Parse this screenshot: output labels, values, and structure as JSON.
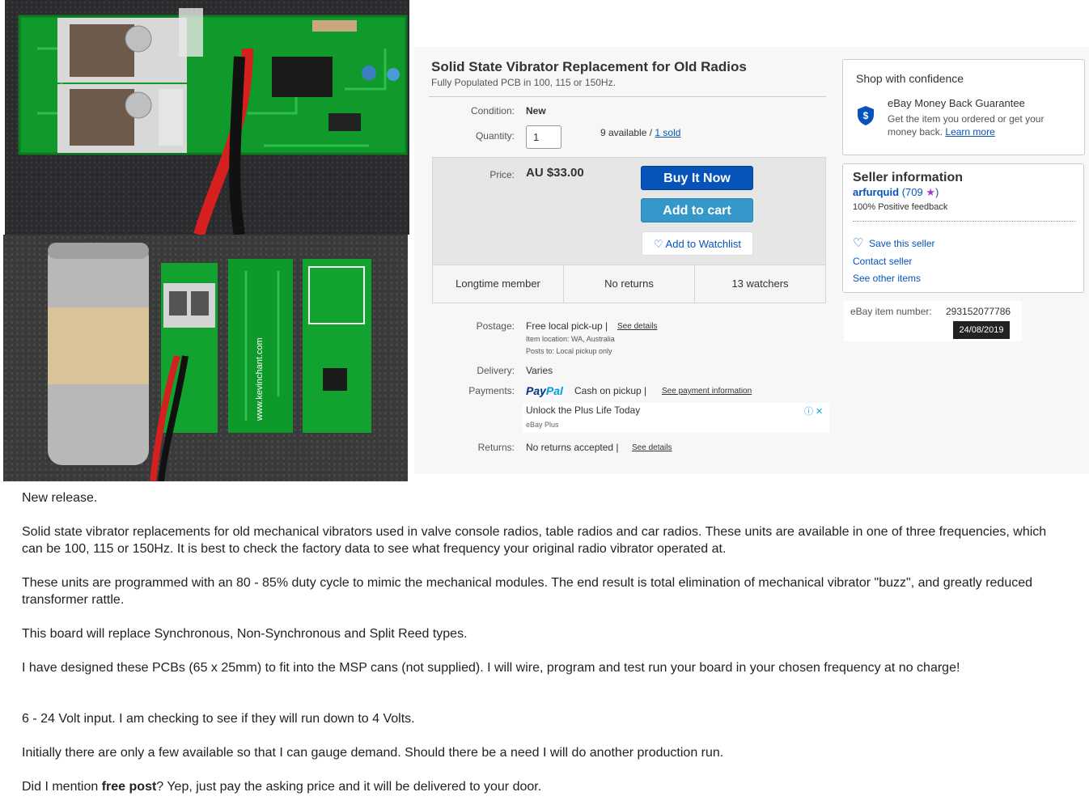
{
  "listing": {
    "title": "Solid State Vibrator Replacement for Old Radios",
    "subtitle": "Fully Populated PCB in 100, 115 or 150Hz.",
    "condition_label": "Condition:",
    "condition_value": "New",
    "quantity_label": "Quantity:",
    "quantity_value": "1",
    "available_text": "9 available /",
    "sold_link": "1 sold",
    "price_label": "Price:",
    "price_value": "AU $33.00",
    "buy_label": "Buy It Now",
    "cart_label": "Add to cart",
    "watch_label": "Add to Watchlist",
    "stats": [
      "Longtime member",
      "No returns",
      "13 watchers"
    ],
    "postage_label": "Postage:",
    "postage_value": "Free local pick-up |",
    "postage_link": "See details",
    "item_location": "Item location:  WA, Australia",
    "posts_to": "Posts to:  Local pickup only",
    "delivery_label": "Delivery:",
    "delivery_value": "Varies",
    "payments_label": "Payments:",
    "paypal_1": "Pay",
    "paypal_2": "Pal",
    "cash_value": "Cash on pickup  |",
    "payment_link": "See payment information",
    "ad_title": "Unlock the Plus Life Today",
    "ad_sub": "eBay Plus",
    "returns_label": "Returns:",
    "returns_value": "No returns accepted |",
    "returns_link": "See details"
  },
  "confidence": {
    "title": "Shop with confidence",
    "mbg_title": "eBay Money Back Guarantee",
    "mbg_desc": "Get the item you ordered or get your money back.",
    "learn_more": "Learn more"
  },
  "seller": {
    "title": "Seller information",
    "name": "arfurquid",
    "score": "(709",
    "close": ")",
    "feedback": "100% Positive feedback",
    "save": "Save this seller",
    "contact": "Contact seller",
    "other": "See other items"
  },
  "item": {
    "number_label": "eBay item number:",
    "number": "293152077786",
    "date": "24/08/2019"
  },
  "photo_text": {
    "website": "www.kevinchant.com"
  },
  "description": {
    "p1": "New release.",
    "p2": "Solid state vibrator replacements for old mechanical vibrators used in valve console radios, table radios and car radios.  These units are available in one of three frequencies, which can be 100, 115 or 150Hz.  It is best to check the factory data to see what frequency your original radio vibrator operated at.",
    "p3": "These units are programmed with an 80 - 85% duty cycle to mimic the mechanical modules.  The end result is  total elimination of mechanical vibrator \"buzz\", and greatly reduced transformer rattle.",
    "p4": "This board will replace Synchronous, Non-Synchronous and Split Reed types.",
    "p5": "I have designed these PCBs (65 x 25mm) to fit into the MSP cans (not supplied).  I will wire, program and test run your board in your chosen frequency at no charge!",
    "p6": "6 - 24 Volt input.  I am checking to see if they will run down to 4 Volts.",
    "p7": "Initially there are only a few available so that I can gauge demand.  Should there be a need I will do another production run.",
    "p8_pre": "Did I mention ",
    "p8_bold": "free post",
    "p8_post": "?  Yep, just pay the asking price and it will be delivered to your door."
  }
}
